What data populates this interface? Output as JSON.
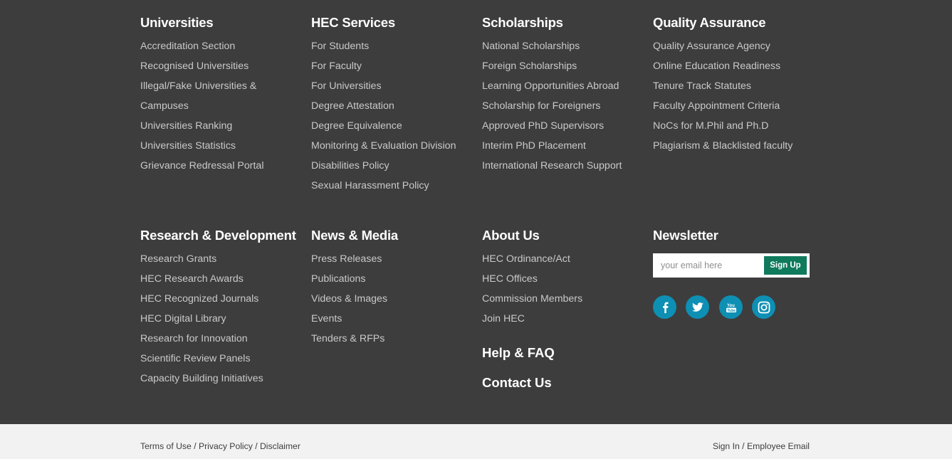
{
  "universities": {
    "heading": "Universities",
    "links": [
      "Accreditation Section",
      "Recognised Universities",
      "Illegal/Fake Universities & Campuses",
      "Universities Ranking",
      "Universities Statistics",
      "Grievance Redressal Portal"
    ]
  },
  "hec_services": {
    "heading": "HEC Services",
    "links": [
      "For Students",
      "For Faculty",
      "For Universities",
      "Degree Attestation",
      "Degree Equivalence",
      "Monitoring & Evaluation Division",
      "Disabilities Policy",
      "Sexual Harassment Policy"
    ]
  },
  "scholarships": {
    "heading": "Scholarships",
    "links": [
      "National Scholarships",
      "Foreign Scholarships",
      "Learning Opportunities Abroad",
      "Scholarship for Foreigners",
      "Approved PhD Supervisors",
      "Interim PhD Placement",
      "International Research Support"
    ]
  },
  "quality_assurance": {
    "heading": "Quality Assurance",
    "links": [
      "Quality Assurance Agency",
      "Online Education Readiness",
      "Tenure Track Statutes",
      "Faculty Appointment Criteria",
      "NoCs for M.Phil and Ph.D",
      "Plagiarism & Blacklisted faculty"
    ]
  },
  "research": {
    "heading": "Research & Development",
    "links": [
      "Research Grants",
      "HEC Research Awards",
      "HEC Recognized Journals",
      "HEC Digital Library",
      "Research for Innovation",
      "Scientific Review Panels",
      "Capacity Building Initiatives"
    ]
  },
  "news_media": {
    "heading": "News & Media",
    "links": [
      "Press Releases",
      "Publications",
      "Videos & Images",
      "Events",
      "Tenders & RFPs"
    ]
  },
  "about": {
    "heading": "About Us",
    "links": [
      "HEC Ordinance/Act",
      "HEC Offices",
      "Commission Members",
      "Join HEC"
    ],
    "help_faq": "Help & FAQ",
    "contact": "Contact Us"
  },
  "newsletter": {
    "heading": "Newsletter",
    "placeholder": "your email here",
    "button": "Sign Up",
    "social": [
      "facebook-icon",
      "twitter-icon",
      "youtube-icon",
      "instagram-icon"
    ]
  },
  "bottom": {
    "terms": "Terms of Use",
    "privacy": "Privacy Policy",
    "disclaimer": "Disclaimer",
    "sign_in": "Sign In",
    "employee_email": "Employee Email",
    "separator": "/"
  },
  "colors": {
    "footer_bg": "#3d3d3d",
    "bottom_bg": "#f2f2f2",
    "accent_green": "#0f7a5c",
    "social_blue": "#0e8fb4"
  }
}
